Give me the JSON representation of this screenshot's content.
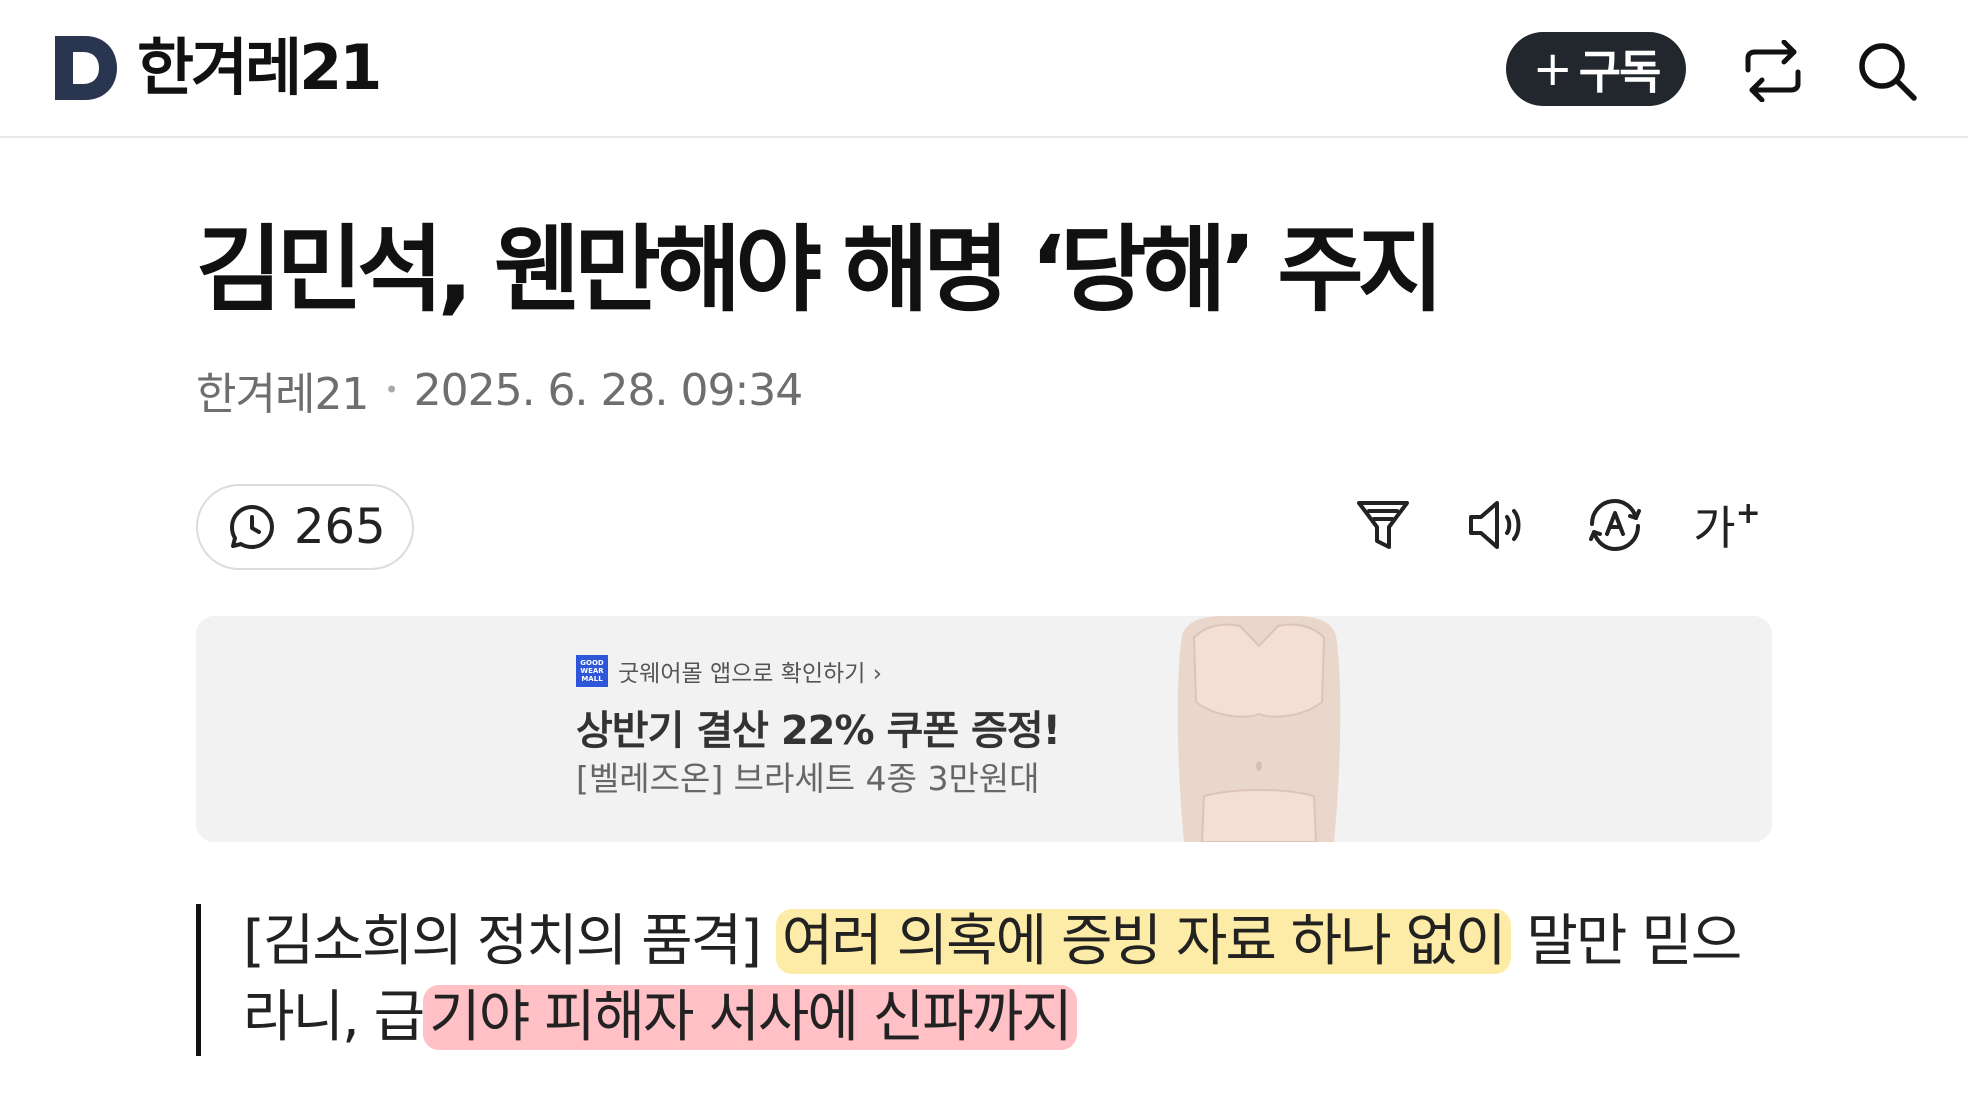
{
  "header": {
    "logo_text": "한겨레21",
    "subscribe_label": "구독",
    "subscribe_plus": "+"
  },
  "article": {
    "title": "김민석, 웬만해야 해명 ‘당해’ 주지",
    "source": "한겨레21",
    "date": "2025. 6. 28. 09:34",
    "comment_count": "265",
    "lead_prefix": "[김소희의 정치의 품격] ",
    "lead_highlight_yellow": "여러 의혹에 증빙 자료 하나 없이",
    "lead_middle": " 말만 믿으라니, 급",
    "lead_highlight_red": "기야 피해자 서사에 신파까지"
  },
  "toolbar": {
    "font_size_label": "가",
    "font_size_plus": "+"
  },
  "ad": {
    "brand_logo": "GOOD WEAR MALL",
    "brand_link": "굿웨어몰 앱으로 확인하기 ›",
    "headline": "상반기 결산 22% 쿠폰 증정!",
    "subline": "[벨레즈온] 브라세트 4종 3만원대"
  },
  "colors": {
    "subscribe_bg": "#22272e",
    "logo_mark": "#2a3550",
    "highlight_yellow": "#fae278",
    "highlight_red": "#ff96a0",
    "ad_bg": "#f2f2f2"
  }
}
